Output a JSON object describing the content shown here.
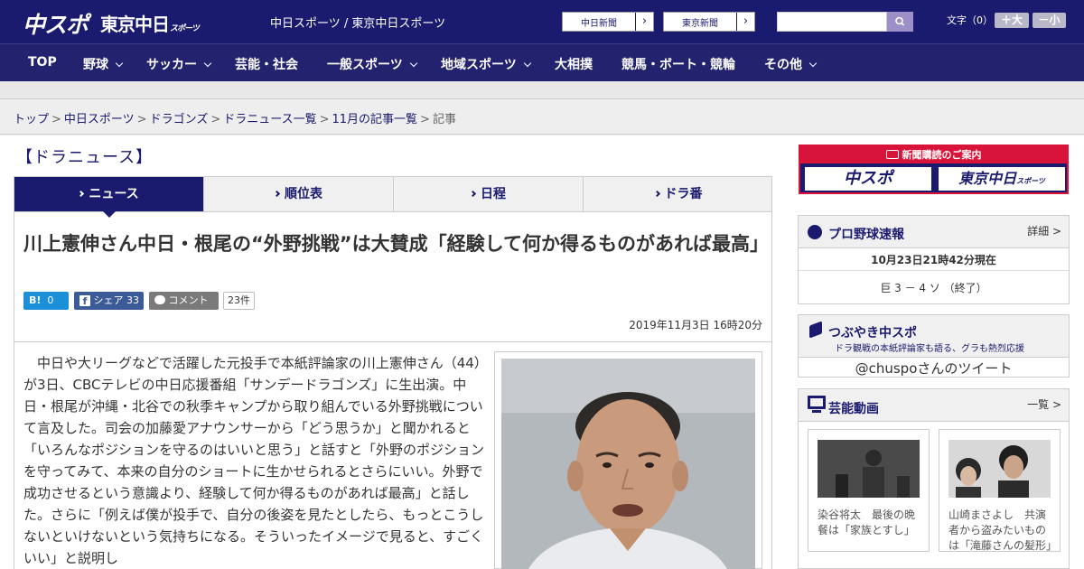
{
  "header": {
    "logo_chunichi": "中スポ",
    "logo_tokyo": "東京中日",
    "logo_tokyo_sub": "スポーツ",
    "site_name": "中日スポーツ / 東京中日スポーツ",
    "paper_buttons": [
      "中日新聞",
      "東京新聞"
    ],
    "font_size_label": "文字（0）",
    "font_larger": "＋大",
    "font_smaller": "－小"
  },
  "nav": {
    "items": [
      {
        "label": "TOP",
        "has_menu": false
      },
      {
        "label": "野球",
        "has_menu": true
      },
      {
        "label": "サッカー",
        "has_menu": true
      },
      {
        "label": "芸能・社会",
        "has_menu": false
      },
      {
        "label": "一般スポーツ",
        "has_menu": true
      },
      {
        "label": "地域スポーツ",
        "has_menu": true
      },
      {
        "label": "大相撲",
        "has_menu": false
      },
      {
        "label": "競馬・ボート・競輪",
        "has_menu": false
      },
      {
        "label": "その他",
        "has_menu": true
      }
    ]
  },
  "breadcrumb": {
    "items": [
      "トップ",
      "中日スポーツ",
      "ドラゴンズ",
      "ドラニュース一覧",
      "11月の記事一覧"
    ],
    "current": "記事",
    "separator": ">"
  },
  "section": {
    "title": "【ドラニュース】"
  },
  "tabs": [
    {
      "label": "ニュース",
      "active": true
    },
    {
      "label": "順位表",
      "active": false
    },
    {
      "label": "日程",
      "active": false
    },
    {
      "label": "ドラ番",
      "active": false
    }
  ],
  "article": {
    "headline": "川上憲伸さん中日・根尾の“外野挑戦”は大賛成「経験して何か得るものがあれば最高」",
    "share": {
      "hatena_label": "B!",
      "hatena_count": "0",
      "facebook_label": "シェア",
      "facebook_count": "33",
      "comment_label": "コメント",
      "comment_count": "23件"
    },
    "date": "2019年11月3日 16時20分",
    "body": "中日や大リーグなどで活躍した元投手で本紙評論家の川上憲伸さん（44）が3日、CBCテレビの中日応援番組「サンデードラゴンズ」に生出演。中日・根尾が沖縄・北谷での秋季キャンプから取り組んでいる外野挑戦について言及した。司会の加藤愛アナウンサーから「どう思うか」と聞かれると「いろんなポジションを守るのはいいと思う」と話すと「外野のポジションを守ってみて、本来の自分のショートに生かせられるとさらにいい。外野で成功させるという意識より、経験して何か得るものがあれば最高」と話した。さらに「例えば僕が投手で、自分の後姿を見たとしたら、もっとこうしないといけないという気持ちになる。そういったイメージで見ると、すごくいい」と説明し"
  },
  "sidebar": {
    "ad": {
      "title": "新聞購読のご案内",
      "paper1": "中スポ",
      "paper2": "東京中日",
      "paper2_sub": "スポーツ"
    },
    "baseball": {
      "title": "プロ野球速報",
      "link": "詳細 >",
      "updated": "10月23日21時42分現在",
      "score": "巨 3 － 4 ソ （終了）"
    },
    "tweets": {
      "title": "つぶやき中スポ",
      "subtitle": "ドラ観戦の本紙評論家も語る、グラも熱烈応援",
      "link_text": "@chuspoさんのツイート"
    },
    "videos": {
      "title": "芸能動画",
      "link": "一覧 >",
      "items": [
        {
          "caption": "染谷将太　最後の晩餐は「家族とすし」"
        },
        {
          "caption": "山崎まさよし　共演者から盗みたいものは「滝藤さんの髪形」"
        }
      ]
    }
  },
  "colors": {
    "header_bg": "#1a1a6e",
    "nav_bg": "#22226e",
    "ad_red": "#d8143a",
    "hatena_blue": "#1b8fd8",
    "facebook_blue": "#3b5a98"
  }
}
